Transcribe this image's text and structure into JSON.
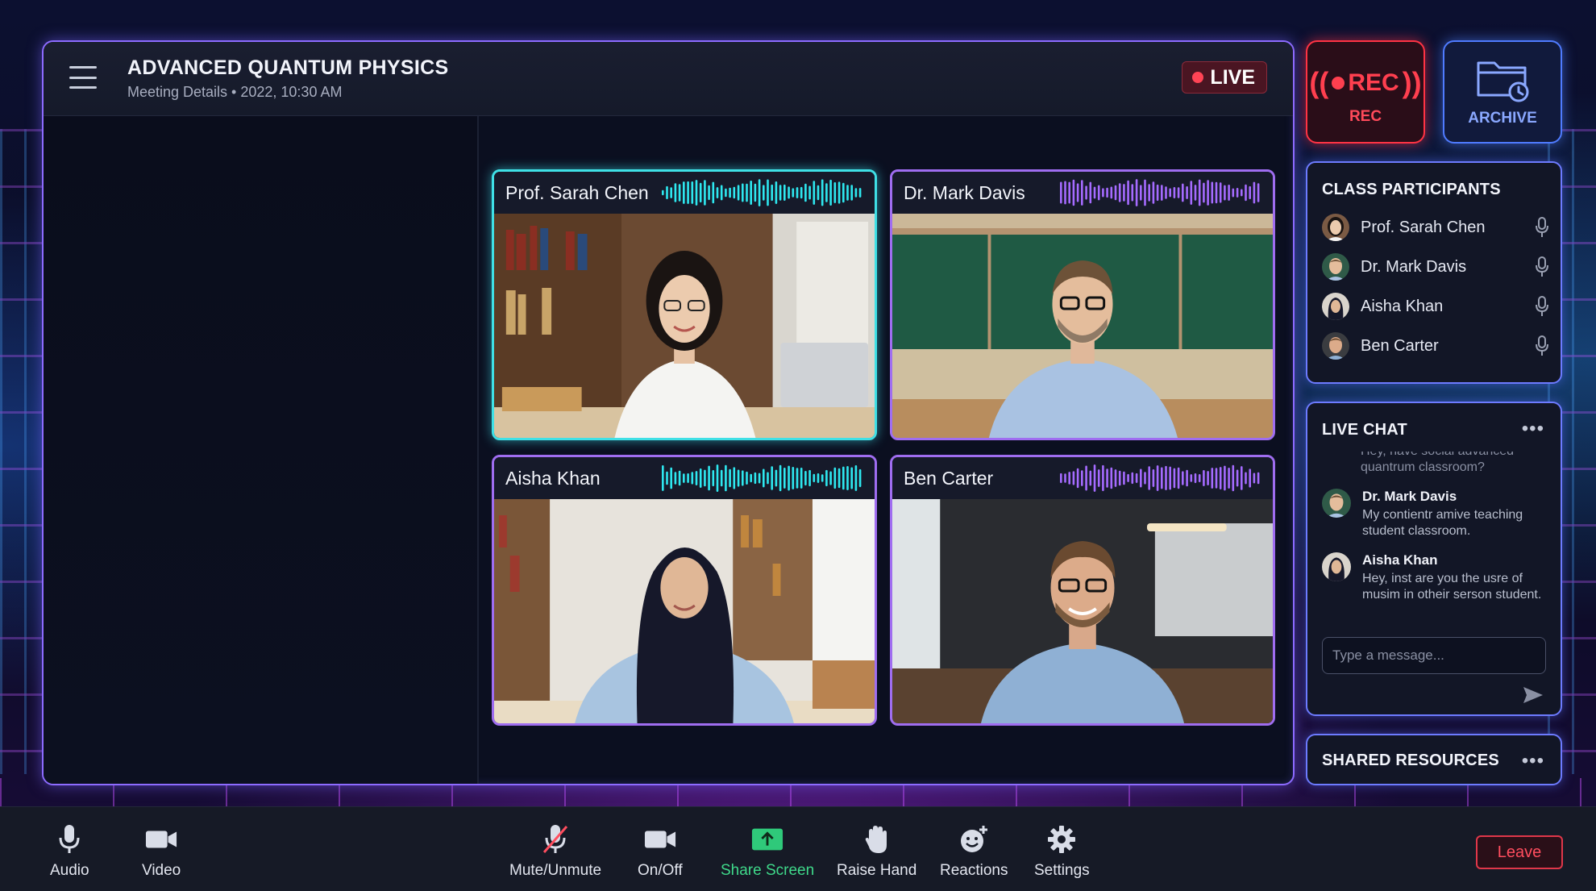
{
  "header": {
    "title": "ADVANCED QUANTUM PHYSICS",
    "subtitle": "Meeting Details • 2022, 10:30 AM",
    "live_label": "LIVE"
  },
  "tiles": [
    {
      "name": "Prof. Sarah Chen",
      "active": true,
      "wave_color": "#2ee8f0"
    },
    {
      "name": "Dr. Mark Davis",
      "active": false,
      "wave_color": "#a56bff"
    },
    {
      "name": "Aisha Khan",
      "active": false,
      "wave_color": "#2ee8f0"
    },
    {
      "name": "Ben Carter",
      "active": false,
      "wave_color": "#a56bff"
    }
  ],
  "controls": {
    "rec_glyph": "REC",
    "rec_label": "REC",
    "archive_label": "ARCHIVE"
  },
  "participants": {
    "title": "CLASS PARTICIPANTS",
    "items": [
      {
        "name": "Prof. Sarah Chen",
        "icon": "mic-icon"
      },
      {
        "name": "Dr. Mark Davis",
        "icon": "mic-icon"
      },
      {
        "name": "Aisha Khan",
        "icon": "mic-icon"
      },
      {
        "name": "Ben Carter",
        "icon": "mic-icon"
      }
    ]
  },
  "chat": {
    "title": "LIVE CHAT",
    "more": "•••",
    "faded_text": "Hey, have social advanced quantrum classroom?",
    "messages": [
      {
        "author": "Dr. Mark Davis",
        "text": "My contientr amive teaching student classroom."
      },
      {
        "author": "Aisha Khan",
        "text": "Hey, inst are you the usre of musim in otheir serson student."
      }
    ],
    "input_placeholder": "Type a message..."
  },
  "resources": {
    "title": "SHARED RESOURCES",
    "more": "•••"
  },
  "toolbar": {
    "audio": "Audio",
    "video": "Video",
    "mute": "Mute/Unmute",
    "onoff": "On/Off",
    "share": "Share Screen",
    "raise": "Raise Hand",
    "reactions": "Reactions",
    "settings": "Settings",
    "leave": "Leave"
  },
  "colors": {
    "accent_cyan": "#3fe0e6",
    "accent_purple": "#9f6df0",
    "live_red": "#ff4455",
    "share_green": "#3fd98a"
  }
}
